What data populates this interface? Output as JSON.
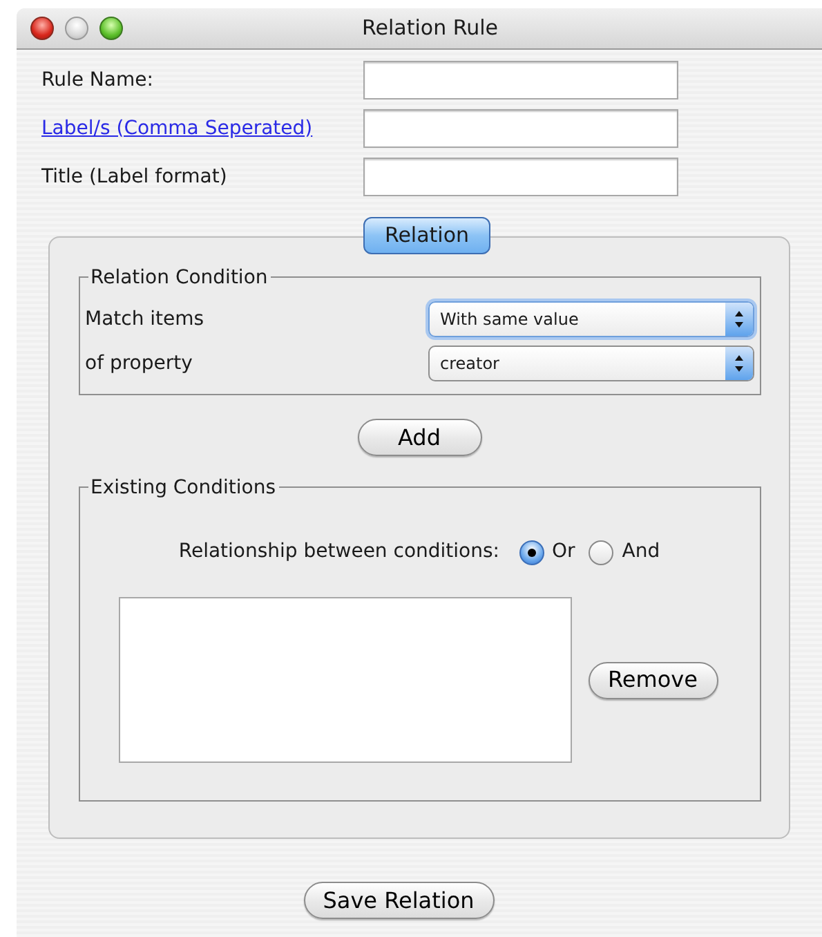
{
  "window": {
    "title": "Relation Rule"
  },
  "fields": [
    {
      "label": "Rule Name:",
      "kind": "plain"
    },
    {
      "label": "Label/s (Comma Seperated)",
      "kind": "link"
    },
    {
      "label": "Title (Label format)",
      "kind": "plain"
    }
  ],
  "tab": {
    "label": "Relation",
    "selected": true
  },
  "relation_condition": {
    "title": "Relation Condition",
    "rows": [
      {
        "label": "Match items",
        "value": "With same value",
        "focused": true
      },
      {
        "label": "of property",
        "value": "creator",
        "focused": false
      }
    ]
  },
  "add_button": "Add",
  "existing_conditions": {
    "title": "Existing Conditions",
    "relationship_label": "Relationship between conditions:",
    "options": [
      {
        "label": "Or",
        "selected": true
      },
      {
        "label": "And",
        "selected": false
      }
    ],
    "remove_button": "Remove"
  },
  "save_button": "Save Relation"
}
